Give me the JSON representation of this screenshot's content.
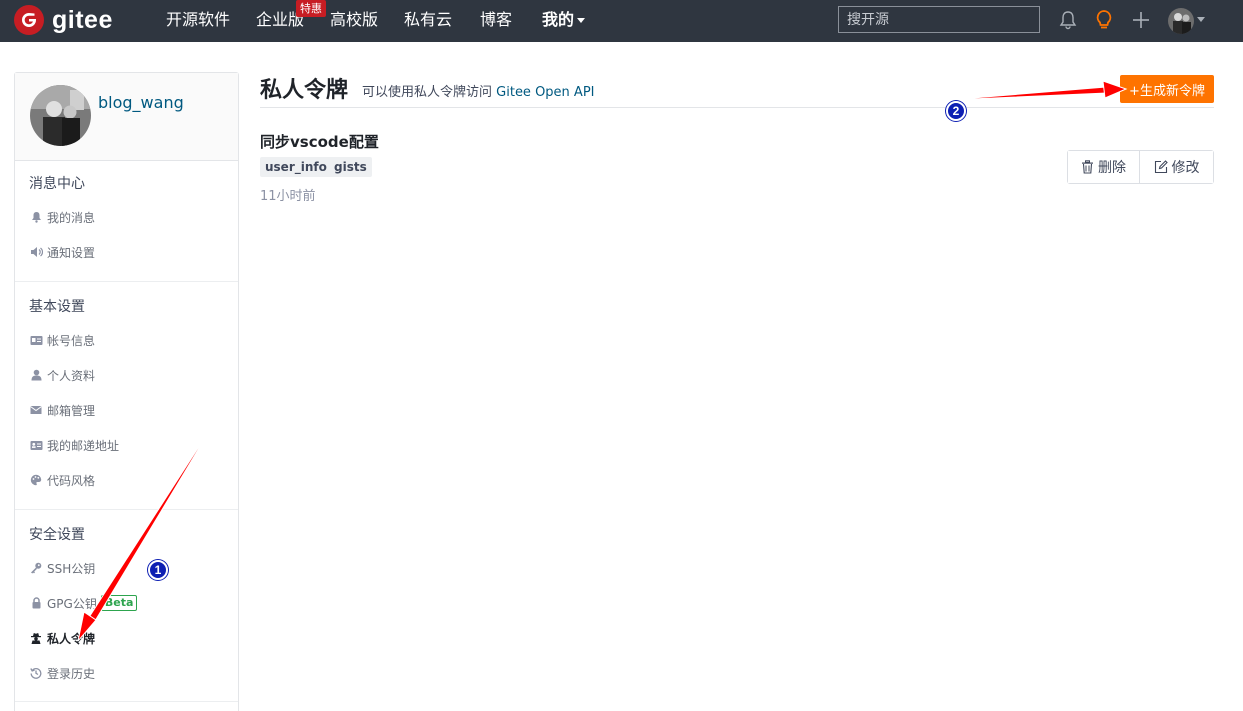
{
  "navbar": {
    "logo_text": "gitee",
    "items": [
      {
        "label": "开源软件"
      },
      {
        "label": "企业版"
      },
      {
        "label": "高校版"
      },
      {
        "label": "私有云"
      },
      {
        "label": "博客"
      },
      {
        "label": "我的"
      }
    ],
    "promo_badge": "特惠",
    "search_placeholder": "搜开源",
    "icons": [
      "bell-icon",
      "lightbulb-icon",
      "plus-icon",
      "user-avatar"
    ],
    "accent_color": "#fe7300"
  },
  "sidebar": {
    "username": "blog_wang",
    "groups": [
      {
        "title": "消息中心",
        "items": [
          {
            "label": "我的消息",
            "icon": "bell-icon"
          },
          {
            "label": "通知设置",
            "icon": "speaker-icon"
          }
        ]
      },
      {
        "title": "基本设置",
        "items": [
          {
            "label": "帐号信息",
            "icon": "id-card-icon"
          },
          {
            "label": "个人资料",
            "icon": "user-icon"
          },
          {
            "label": "邮箱管理",
            "icon": "envelope-icon"
          },
          {
            "label": "我的邮递地址",
            "icon": "address-card-icon"
          },
          {
            "label": "代码风格",
            "icon": "palette-icon"
          }
        ]
      },
      {
        "title": "安全设置",
        "items": [
          {
            "label": "SSH公钥",
            "icon": "key-icon"
          },
          {
            "label": "GPG公钥",
            "icon": "lock-icon",
            "badge": "Beta"
          },
          {
            "label": "私人令牌",
            "icon": "user-secret-icon",
            "active": true
          },
          {
            "label": "登录历史",
            "icon": "history-icon"
          }
        ]
      }
    ]
  },
  "main": {
    "title": "私人令牌",
    "description": "可以使用私人令牌访问",
    "description_link": "Gitee Open API",
    "new_token_button": "+生成新令牌",
    "token": {
      "name": "同步vscode配置",
      "scopes": [
        "user_info",
        "gists"
      ],
      "time": "11小时前",
      "delete_label": "删除",
      "edit_label": "修改"
    }
  },
  "annotations": {
    "marker_1": "1",
    "marker_2": "2",
    "arrow_color": "#ff0000",
    "marker_color": "#0d1fb3"
  }
}
